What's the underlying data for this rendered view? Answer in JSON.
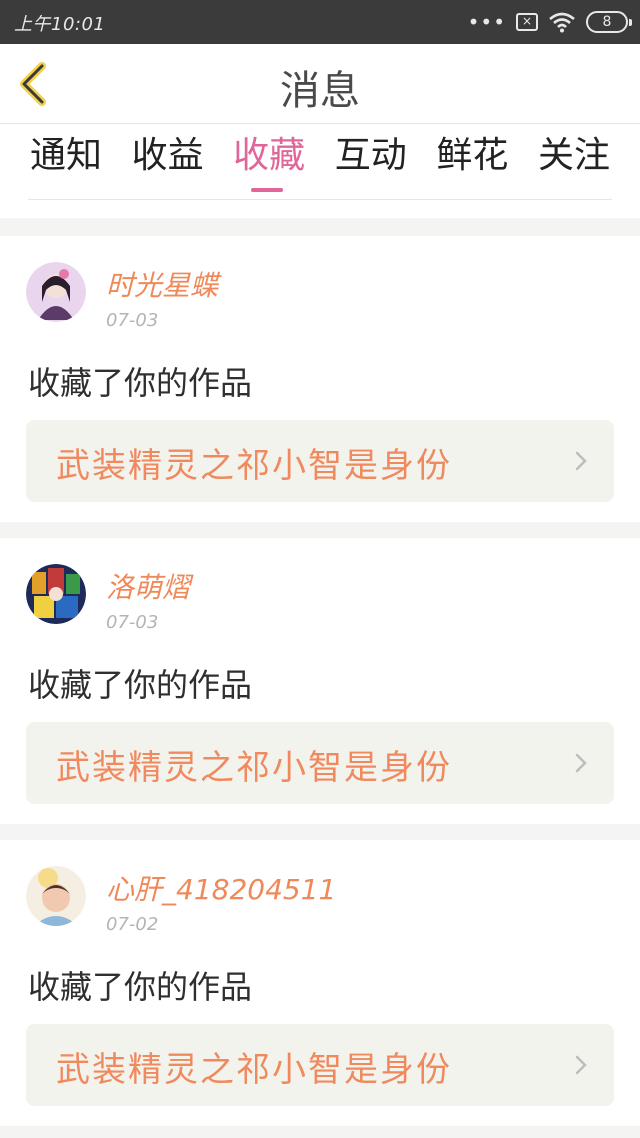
{
  "status_bar": {
    "time": "上午10:01",
    "dots": "•••",
    "sim_label": "×",
    "battery": "8"
  },
  "header": {
    "title": "消息"
  },
  "tabs": [
    {
      "label": "通知"
    },
    {
      "label": "收益"
    },
    {
      "label": "收藏"
    },
    {
      "label": "互动"
    },
    {
      "label": "鲜花"
    },
    {
      "label": "关注"
    }
  ],
  "active_tab": "收藏",
  "colors": {
    "accent": "#e0669a",
    "orange_text": "#f0895a"
  },
  "messages": [
    {
      "user": "时光星蝶",
      "date": "07-03",
      "action": "收藏了你的作品",
      "work": "武装精灵之祁小智是身份"
    },
    {
      "user": "洛萌熠",
      "date": "07-03",
      "action": "收藏了你的作品",
      "work": "武装精灵之祁小智是身份"
    },
    {
      "user": "心肝_418204511",
      "date": "07-02",
      "action": "收藏了你的作品",
      "work": "武装精灵之祁小智是身份"
    }
  ]
}
